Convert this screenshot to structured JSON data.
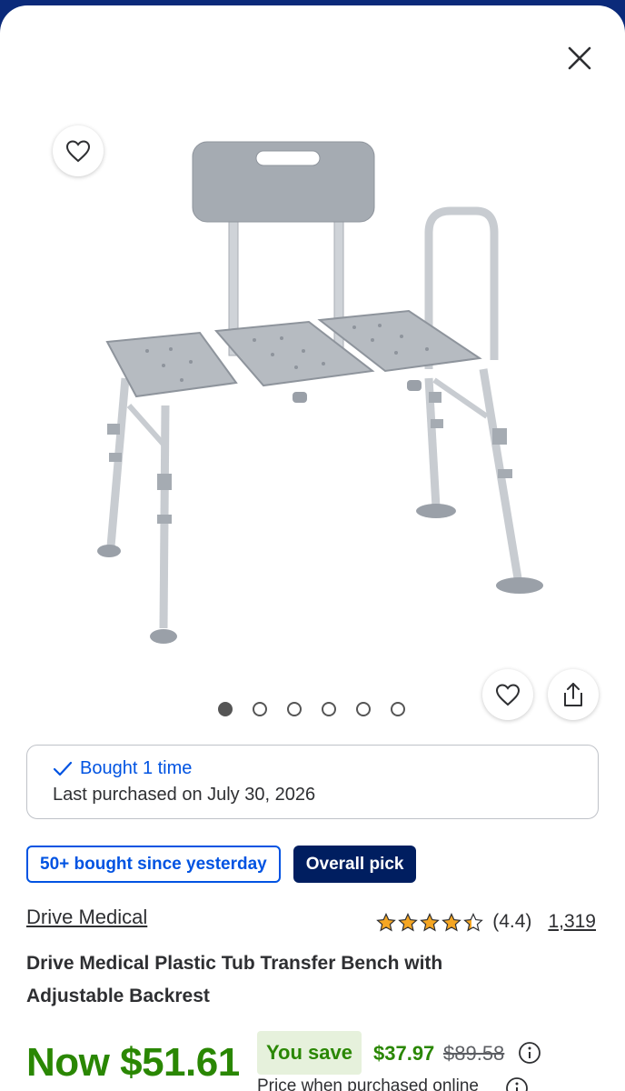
{
  "icons": {
    "close": "close-icon",
    "favorite": "heart-icon",
    "share": "share-icon",
    "check": "checkmark-icon",
    "info": "info-icon",
    "star": "star-icon"
  },
  "colors": {
    "accent_blue": "#0053e2",
    "navy": "#001e60",
    "price_green": "#2a8703",
    "star_gold": "#f5a623"
  },
  "carousel": {
    "total": 6,
    "active_index": 0
  },
  "purchase_history": {
    "bought_label": "Bought 1 time",
    "last_purchased": "Last purchased on July 30, 2026"
  },
  "badges": {
    "popularity": "50+ bought since yesterday",
    "pick": "Overall pick"
  },
  "product": {
    "brand": "Drive Medical",
    "title": "Drive Medical Plastic Tub Transfer Bench with Adjustable Backrest",
    "rating": 4.4,
    "rating_text": "(4.4)",
    "review_count": "1,319"
  },
  "pricing": {
    "now_price": "Now $51.61",
    "you_save_label": "You save",
    "save_amount": "$37.97",
    "was_price": "$89.58",
    "online_note": "Price when purchased online"
  }
}
